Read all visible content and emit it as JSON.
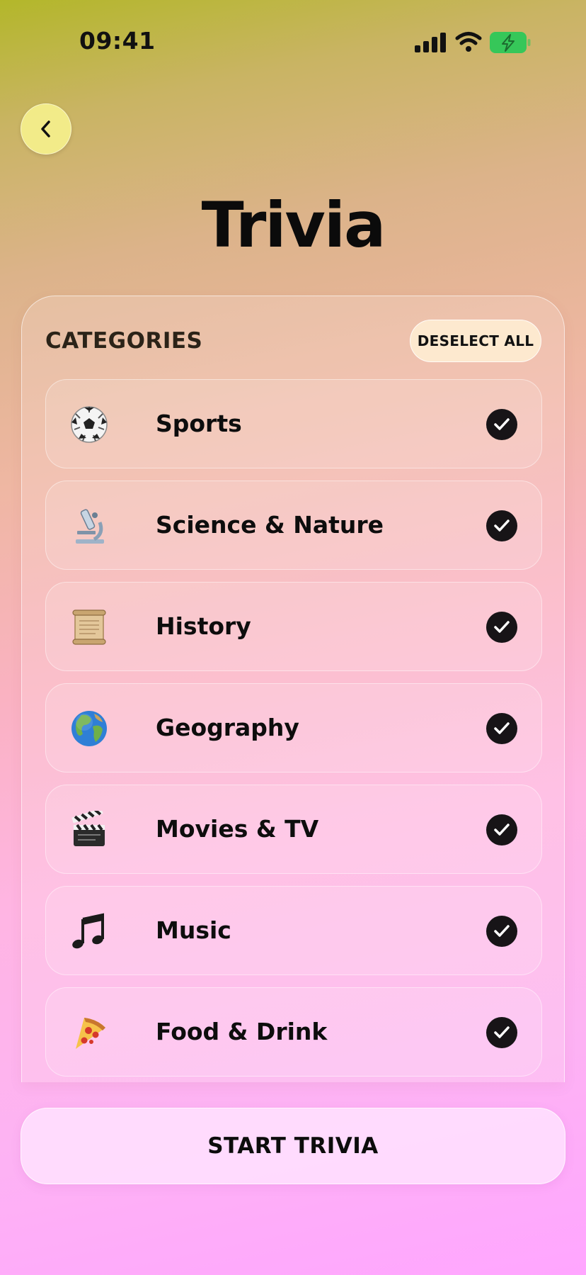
{
  "status_bar": {
    "time": "09:41",
    "battery_color": "#36c759"
  },
  "header": {
    "back_icon": "chevron-left-icon",
    "title": "Trivia"
  },
  "categories": {
    "heading": "CATEGORIES",
    "deselect_label": "DESELECT ALL",
    "items": [
      {
        "label": "Sports",
        "icon": "soccer-ball-icon",
        "selected": true
      },
      {
        "label": "Science & Nature",
        "icon": "microscope-icon",
        "selected": true
      },
      {
        "label": "History",
        "icon": "scroll-icon",
        "selected": true
      },
      {
        "label": "Geography",
        "icon": "globe-icon",
        "selected": true
      },
      {
        "label": "Movies & TV",
        "icon": "clapper-board-icon",
        "selected": true
      },
      {
        "label": "Music",
        "icon": "music-note-icon",
        "selected": true
      },
      {
        "label": "Food & Drink",
        "icon": "pizza-icon",
        "selected": true
      }
    ]
  },
  "footer": {
    "start_label": "START TRIVIA"
  },
  "colors": {
    "gradient_top": "#b3b72a",
    "gradient_bottom": "#ffa6ff",
    "check_fill": "#171417",
    "back_button_fill": "#f5f08c"
  }
}
